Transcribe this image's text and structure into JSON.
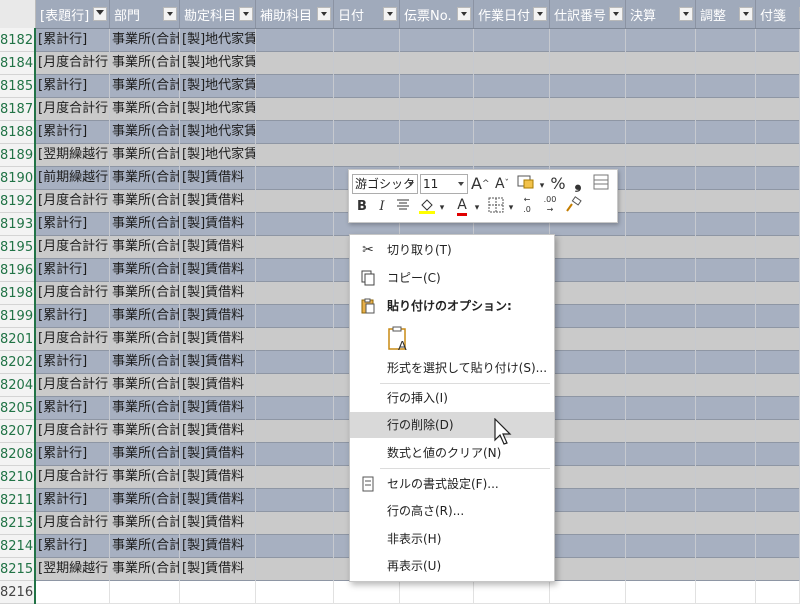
{
  "columns": [
    {
      "label": "[表題行]",
      "filter": true
    },
    {
      "label": "部門",
      "filter": false
    },
    {
      "label": "勘定科目",
      "filter": false
    },
    {
      "label": "補助科目",
      "filter": false
    },
    {
      "label": "日付",
      "filter": false
    },
    {
      "label": "伝票No.",
      "filter": false
    },
    {
      "label": "作業日付",
      "filter": false
    },
    {
      "label": "仕訳番号",
      "filter": false
    },
    {
      "label": "決算",
      "filter": false
    },
    {
      "label": "調整",
      "filter": false
    },
    {
      "label": "付箋",
      "filter": false
    }
  ],
  "rows": [
    {
      "num": "8182",
      "a": "[累計行]",
      "b": "事業所(合計)",
      "c": "[製]地代家賃",
      "style": "blue"
    },
    {
      "num": "8184",
      "a": "[月度合計行]",
      "b": "事業所(合計)",
      "c": "[製]地代家賃",
      "style": "gray"
    },
    {
      "num": "8185",
      "a": "[累計行]",
      "b": "事業所(合計)",
      "c": "[製]地代家賃",
      "style": "blue"
    },
    {
      "num": "8187",
      "a": "[月度合計行]",
      "b": "事業所(合計)",
      "c": "[製]地代家賃",
      "style": "gray"
    },
    {
      "num": "8188",
      "a": "[累計行]",
      "b": "事業所(合計)",
      "c": "[製]地代家賃",
      "style": "blue"
    },
    {
      "num": "8189",
      "a": "[翌期繰越行]",
      "b": "事業所(合計)",
      "c": "[製]地代家賃",
      "style": "gray"
    },
    {
      "num": "8190",
      "a": "[前期繰越行]",
      "b": "事業所(合計)",
      "c": "[製]賃借料",
      "style": "blue"
    },
    {
      "num": "8192",
      "a": "[月度合計行]",
      "b": "事業所(合計)",
      "c": "[製]賃借料",
      "style": "gray"
    },
    {
      "num": "8193",
      "a": "[累計行]",
      "b": "事業所(合計)",
      "c": "[製]賃借料",
      "style": "blue"
    },
    {
      "num": "8195",
      "a": "[月度合計行]",
      "b": "事業所(合計)",
      "c": "[製]賃借料",
      "style": "gray"
    },
    {
      "num": "8196",
      "a": "[累計行]",
      "b": "事業所(合計)",
      "c": "[製]賃借料",
      "style": "blue"
    },
    {
      "num": "8198",
      "a": "[月度合計行]",
      "b": "事業所(合計)",
      "c": "[製]賃借料",
      "style": "gray"
    },
    {
      "num": "8199",
      "a": "[累計行]",
      "b": "事業所(合計)",
      "c": "[製]賃借料",
      "style": "blue"
    },
    {
      "num": "8201",
      "a": "[月度合計行]",
      "b": "事業所(合計)",
      "c": "[製]賃借料",
      "style": "gray"
    },
    {
      "num": "8202",
      "a": "[累計行]",
      "b": "事業所(合計)",
      "c": "[製]賃借料",
      "style": "blue"
    },
    {
      "num": "8204",
      "a": "[月度合計行]",
      "b": "事業所(合計)",
      "c": "[製]賃借料",
      "style": "gray"
    },
    {
      "num": "8205",
      "a": "[累計行]",
      "b": "事業所(合計)",
      "c": "[製]賃借料",
      "style": "blue"
    },
    {
      "num": "8207",
      "a": "[月度合計行]",
      "b": "事業所(合計)",
      "c": "[製]賃借料",
      "style": "gray"
    },
    {
      "num": "8208",
      "a": "[累計行]",
      "b": "事業所(合計)",
      "c": "[製]賃借料",
      "style": "blue"
    },
    {
      "num": "8210",
      "a": "[月度合計行]",
      "b": "事業所(合計)",
      "c": "[製]賃借料",
      "style": "gray"
    },
    {
      "num": "8211",
      "a": "[累計行]",
      "b": "事業所(合計)",
      "c": "[製]賃借料",
      "style": "blue"
    },
    {
      "num": "8213",
      "a": "[月度合計行]",
      "b": "事業所(合計)",
      "c": "[製]賃借料",
      "style": "gray"
    },
    {
      "num": "8214",
      "a": "[累計行]",
      "b": "事業所(合計)",
      "c": "[製]賃借料",
      "style": "blue"
    },
    {
      "num": "8215",
      "a": "[翌期繰越行]",
      "b": "事業所(合計)",
      "c": "[製]賃借料",
      "style": "gray"
    },
    {
      "num": "8216",
      "a": "",
      "b": "",
      "c": "",
      "style": "white"
    }
  ],
  "mini_toolbar": {
    "font_name": "游ゴシック",
    "font_size": "11",
    "grow": "A",
    "shrink": "A",
    "percent": "%",
    "comma": "❟",
    "bold": "B",
    "italic": "I",
    "fill_color": "#ffff00",
    "font_color": "#ff0000",
    "dec_inc": ".00",
    "dec_dec": ".0"
  },
  "context_menu": {
    "cut": "切り取り(T)",
    "copy": "コピー(C)",
    "paste_options": "貼り付けのオプション:",
    "paste_special": "形式を選択して貼り付け(S)...",
    "insert_row": "行の挿入(I)",
    "delete_row": "行の削除(D)",
    "clear_contents": "数式と値のクリア(N)",
    "format_cells": "セルの書式設定(F)...",
    "row_height": "行の高さ(R)...",
    "hide": "非表示(H)",
    "unhide": "再表示(U)"
  }
}
